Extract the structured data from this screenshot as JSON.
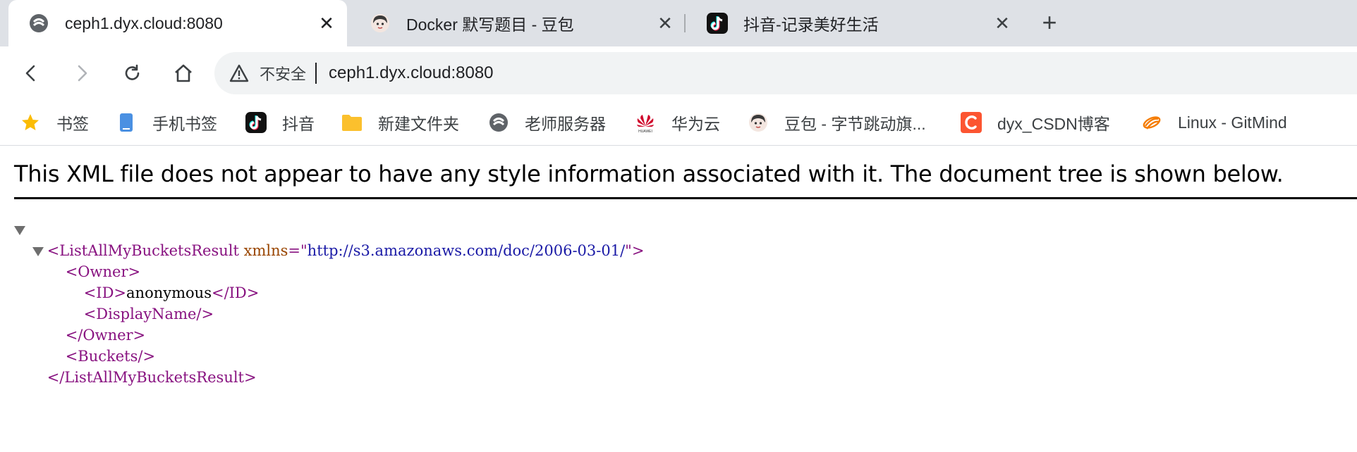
{
  "tabs": [
    {
      "title": "ceph1.dyx.cloud:8080",
      "icon": "ceph-site-icon",
      "active": true
    },
    {
      "title": "Docker 默写题目 - 豆包",
      "icon": "doubao-avatar-icon",
      "active": false
    },
    {
      "title": "抖音-记录美好生活",
      "icon": "douyin-icon",
      "active": false
    }
  ],
  "tab_close_glyph": "✕",
  "new_tab_glyph": "+",
  "omnibox": {
    "security_label": "不安全",
    "url": "ceph1.dyx.cloud:8080"
  },
  "bookmarks": [
    {
      "label": "书签",
      "icon": "star-icon"
    },
    {
      "label": "手机书签",
      "icon": "mobile-bookmark-icon"
    },
    {
      "label": "抖音",
      "icon": "douyin-icon"
    },
    {
      "label": "新建文件夹",
      "icon": "folder-icon"
    },
    {
      "label": "老师服务器",
      "icon": "server-site-icon"
    },
    {
      "label": "华为云",
      "icon": "huawei-icon"
    },
    {
      "label": "豆包 - 字节跳动旗...",
      "icon": "doubao-avatar-icon"
    },
    {
      "label": "dyx_CSDN博客",
      "icon": "csdn-icon"
    },
    {
      "label": "Linux - GitMind",
      "icon": "gitmind-icon"
    }
  ],
  "page": {
    "banner": "This XML file does not appear to have any style information associated with it. The document tree is shown below.",
    "xml": {
      "root_open": "<ListAllMyBucketsResult",
      "attr_name": "xmlns",
      "attr_eq": "=\"",
      "attr_value": "http://s3.amazonaws.com/doc/2006-03-01/",
      "attr_close": "\">",
      "owner_open": "<Owner>",
      "id_open": "<ID>",
      "id_value": "anonymous",
      "id_close": "</ID>",
      "display_name": "<DisplayName/>",
      "owner_close": "</Owner>",
      "buckets": "<Buckets/>",
      "root_close": "</ListAllMyBucketsResult>"
    }
  },
  "colors": {
    "tabstrip_bg": "#dee1e6",
    "tag": "#881280",
    "attr_name": "#994500",
    "attr_value": "#1a1aa6"
  }
}
